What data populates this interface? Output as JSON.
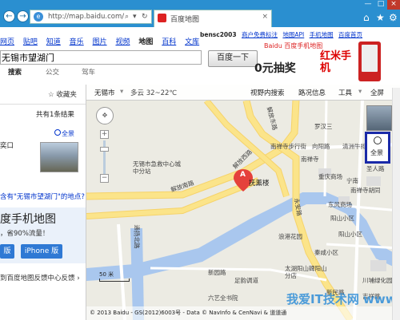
{
  "browser": {
    "url": "http://map.baidu.com/",
    "tab_title": "百度地图",
    "tab_close": "×",
    "back": "←",
    "forward": "→",
    "win_min": "—",
    "win_max": "□",
    "win_close": "×"
  },
  "header": {
    "top_links": [
      "bensc2003",
      "商户免费标注",
      "地图API",
      "手机地图",
      "百度首页"
    ],
    "nav": [
      "网页",
      "贴吧",
      "知道",
      "音乐",
      "图片",
      "视频",
      "地图",
      "百科",
      "文库"
    ],
    "search_value": "无锡市望湖门",
    "search_button": "百度一下",
    "modes": [
      "搜索",
      "公交",
      "驾车"
    ]
  },
  "ad": {
    "brand": "Baidu 百度手机地图",
    "text": "0元抽奖",
    "big": "红米手机"
  },
  "left_panel": {
    "favorite": "☆ 收藏夹",
    "count": "共有1条结果",
    "panorama": "全景",
    "result_name": "奕口",
    "question": "含有\"无锡市望湖门\"的地点?",
    "mobile_title": "度手机地图",
    "mobile_save": "，省90%流量！",
    "btn_left": "版",
    "btn_iphone": "iPhone 版",
    "feedback": "到百度地图反馈中心反馈 ›"
  },
  "map": {
    "city": "无锡市",
    "weather": "多云  32~22℃",
    "toolbar": [
      "视野内搜索",
      "路况信息",
      "工具",
      "全屏"
    ],
    "labels": {
      "jiefang_e": "解放东路",
      "jiefang_s": "解放南路",
      "jiefang_sw": "解放西路",
      "nanchan": "南禅寺步行街",
      "xiangyang": "向阳路",
      "yongan": "永安路",
      "luohan": "罗汉三",
      "qinghong": "清洲牛排",
      "nanchan_temple": "南禅寺",
      "shengren": "圣人路",
      "emergency": "无锡市急救中心城中分站",
      "fuyuan": "抚薰楼",
      "tongyang": "通扬北路",
      "xinyuan": "新园路",
      "langpu": "浪港花园",
      "taihu": "太湖阳山碑阳山分店",
      "xinmin": "新民路",
      "qinxian": "秦咸小区",
      "zuyi": "足韵调道",
      "liuyiquan": "六艺全书院",
      "chongqing": "重庆商场",
      "dongfeng": "东风商场",
      "yangshan1": "阳山小区",
      "yangshan2": "阳山小区",
      "nanchan_hutong": "南禅寺胡同",
      "xinyuan_s": "新园小区",
      "yangshan_lu": "阳山路",
      "jixiang": "吉祥路",
      "chuanjiang": "川埔绿化园",
      "ningnan": "宁南",
      "marker": "A"
    },
    "scale": "50 米",
    "copyright": "© 2013 Baidu - GS(2012)6003号 - Data © NavInfo & CenNavi & 道道通",
    "panorama_btn": "全景"
  },
  "watermark": "我爱IT技术网 www.52ij.com",
  "colors": {
    "chrome": "#2a8fd0",
    "link": "#0033cc",
    "river": "#a9c7ee",
    "road": "#fbe48a",
    "marker": "#e5413b"
  }
}
